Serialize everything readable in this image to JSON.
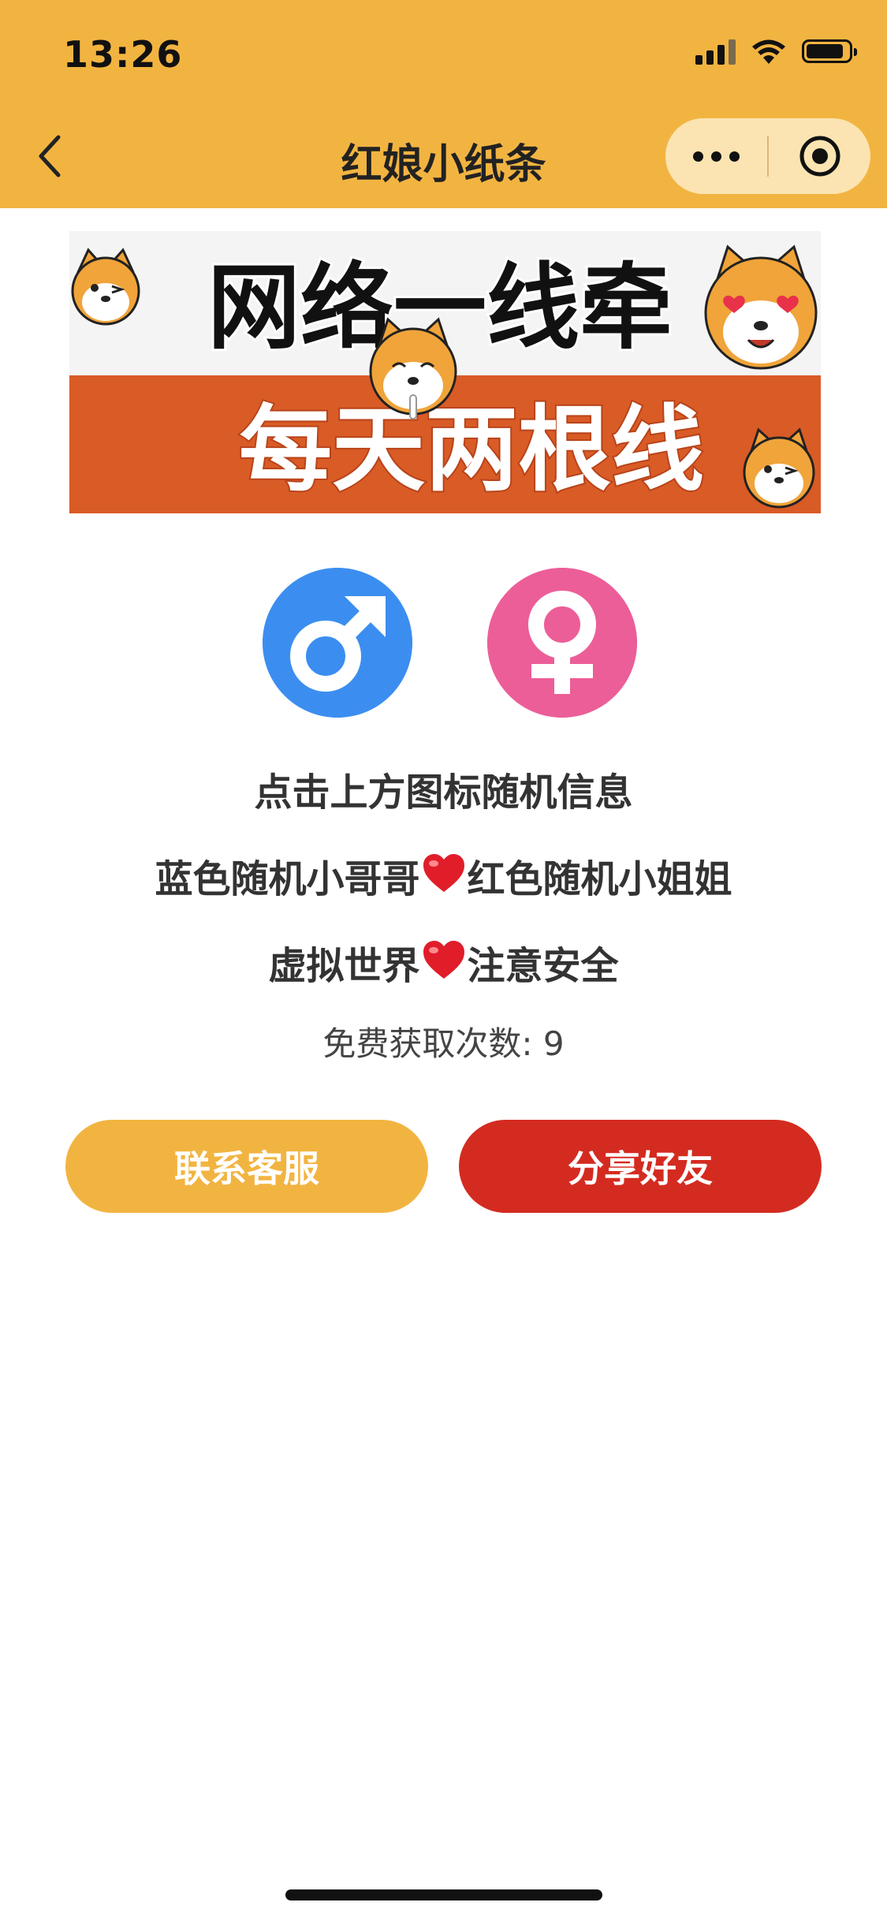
{
  "status_bar": {
    "time": "13:26"
  },
  "navbar": {
    "title": "红娘小纸条",
    "back_icon": "chevron-left-icon",
    "more_icon": "more-dots-icon",
    "close_icon": "target-circle-icon"
  },
  "banner": {
    "line1": "网络一线牵",
    "line2": "每天两根线",
    "colors": {
      "top_bg": "#f4f4f4",
      "bottom_bg": "#d95b26",
      "line1_text": "#111111",
      "line2_text": "#ffffff"
    }
  },
  "gender_buttons": {
    "male_icon": "male-symbol-icon",
    "female_icon": "female-symbol-icon",
    "male_color": "#3b8ef0",
    "female_color": "#ec5e98"
  },
  "info": {
    "line1": "点击上方图标随机信息",
    "line2_left": "蓝色随机小哥哥",
    "line2_right": "红色随机小姐姐",
    "line3_left": "虚拟世界",
    "line3_right": "注意安全",
    "free_count": "免费获取次数: 9"
  },
  "buttons": {
    "contact": "联系客服",
    "share": "分享好友",
    "contact_color": "#f2b441",
    "share_color": "#d42b20"
  },
  "colors": {
    "header_bg": "#f2b441",
    "capsule_bg": "#fbe4b1"
  }
}
